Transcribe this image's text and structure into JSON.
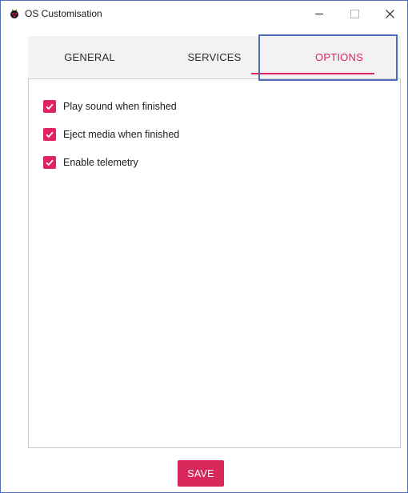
{
  "window": {
    "title": "OS Customisation",
    "controls": {
      "minimize_icon": "minimize-icon",
      "maximize_icon": "maximize-icon",
      "close_icon": "close-icon"
    }
  },
  "tabs": [
    {
      "label": "GENERAL",
      "active": false
    },
    {
      "label": "SERVICES",
      "active": false
    },
    {
      "label": "OPTIONS",
      "active": true
    }
  ],
  "options": [
    {
      "label": "Play sound when finished",
      "checked": true
    },
    {
      "label": "Eject media when finished",
      "checked": true
    },
    {
      "label": "Enable telemetry",
      "checked": true
    }
  ],
  "footer": {
    "save_label": "SAVE"
  },
  "colors": {
    "accent": "#e0245f",
    "highlight_border": "#4a6db5",
    "tab_background": "#f2f2f2"
  }
}
